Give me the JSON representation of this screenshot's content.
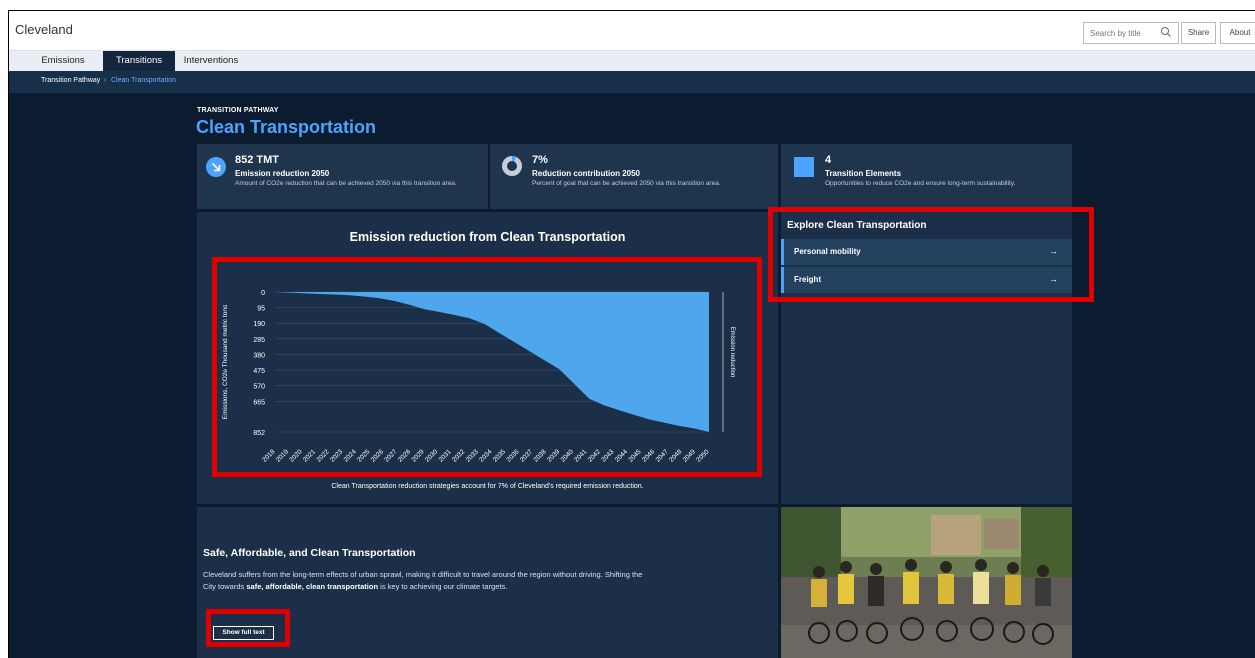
{
  "app": {
    "title": "Cleveland"
  },
  "header": {
    "search_placeholder": "Search by title",
    "share_label": "Share",
    "about_label": "About"
  },
  "tabs": [
    {
      "label": "Emissions",
      "active": false
    },
    {
      "label": "Transitions",
      "active": true
    },
    {
      "label": "Interventions",
      "active": false
    }
  ],
  "breadcrumb": {
    "parent": "Transition Pathway",
    "separator": "›",
    "current": "Clean Transportation"
  },
  "page": {
    "pre_title": "TRANSITION PATHWAY",
    "title": "Clean Transportation"
  },
  "stats": [
    {
      "value": "852 TMT",
      "label": "Emission reduction 2050",
      "description": "Amount of CO2e reduction that can be achieved 2050 via this transition area.",
      "icon": "arrow-down-right-icon"
    },
    {
      "value": "7%",
      "label": "Reduction contribution 2050",
      "description": "Percent of goal that can be achieved 2050 via this transition area.",
      "icon": "donut-chart-icon",
      "fraction": 0.07
    },
    {
      "value": "4",
      "label": "Transition Elements",
      "description": "Opportunities to reduce CO2e and ensure long-term sustainability.",
      "icon": "square-icon"
    }
  ],
  "chart": {
    "title": "Emission reduction from Clean Transportation",
    "footnote": "Clean Transportation reduction strategies account for 7% of Cleveland's required emission reduction."
  },
  "chart_data": {
    "type": "area",
    "title": "Emission reduction from Clean Transportation",
    "ylabel": "Emissions, CO2e Thousand metric tons",
    "series": [
      {
        "name": "Emission reduction",
        "values": [
          0,
          4,
          8,
          12,
          15,
          20,
          28,
          38,
          55,
          78,
          105,
          122,
          140,
          160,
          195,
          250,
          305,
          360,
          415,
          470,
          560,
          650,
          690,
          720,
          748,
          775,
          795,
          815,
          830,
          852
        ]
      }
    ],
    "x": [
      "2018",
      "2019",
      "2020",
      "2021",
      "2022",
      "2023",
      "2024",
      "2025",
      "2026",
      "2027",
      "2028",
      "2029",
      "2030",
      "2031",
      "2032",
      "2033",
      "2034",
      "2035",
      "2036",
      "2037",
      "2038",
      "2039",
      "2040",
      "2041",
      "2042",
      "2043",
      "2044",
      "2045",
      "2046",
      "2047",
      "2048",
      "2049",
      "2050"
    ],
    "x_ticks": [
      "2018",
      "2019",
      "2020",
      "2021",
      "2022",
      "2023",
      "2024",
      "2025",
      "2026",
      "2027",
      "2028",
      "2029",
      "2030",
      "2031",
      "2032",
      "2033",
      "2034",
      "2035",
      "2036",
      "2037",
      "2038",
      "2039",
      "2040",
      "2041",
      "2042",
      "2043",
      "2044",
      "2045",
      "2046",
      "2047",
      "2048",
      "2049",
      "2050"
    ],
    "y_ticks": [
      "0",
      "95",
      "190",
      "285",
      "380",
      "475",
      "570",
      "665",
      "852"
    ],
    "ylim": [
      0,
      852
    ],
    "y_inverted": true,
    "area_color": "#4ea6ec"
  },
  "explore": {
    "title": "Explore Clean Transportation",
    "items": [
      {
        "label": "Personal mobility"
      },
      {
        "label": "Freight"
      }
    ]
  },
  "section": {
    "heading": "Safe, Affordable, and Clean Transportation",
    "body_1": "Cleveland suffers from the long-term effects of urban sprawl, making it difficult to travel around the region without driving. Shifting the City towards ",
    "body_bold": "safe, affordable, clean transportation",
    "body_2": " is key to achieving our climate targets.",
    "button_label": "Show full text"
  }
}
